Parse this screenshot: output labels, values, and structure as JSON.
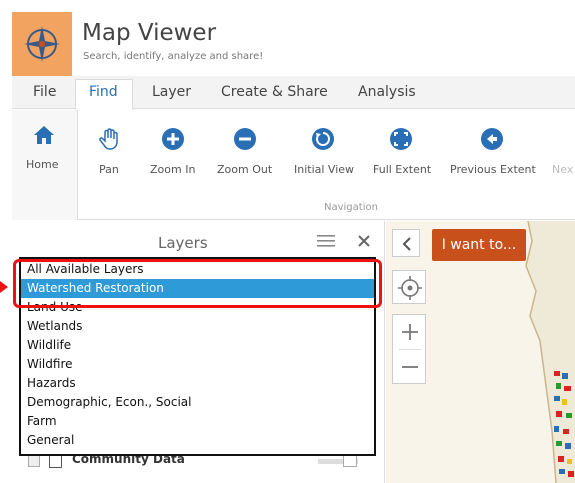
{
  "app": {
    "title": "Map Viewer",
    "subtitle": "Search, identify, analyze and share!"
  },
  "tabs": [
    "File",
    "Find",
    "Layer",
    "Create & Share",
    "Analysis"
  ],
  "ribbon": {
    "home_label": "Home",
    "tools": [
      "Pan",
      "Zoom In",
      "Zoom Out",
      "Initial View",
      "Full Extent",
      "Previous Extent",
      "Nex"
    ],
    "group_label": "Navigation"
  },
  "layers_panel": {
    "title": "Layers",
    "dropdown_options": [
      "All Available Layers",
      "Watershed Restoration",
      "Land Use",
      "Wetlands",
      "Wildlife",
      "Wildfire",
      "Hazards",
      "Demographic, Econ., Social",
      "Farm",
      "General"
    ],
    "selected": "Watershed Restoration",
    "row_label": "Community Data"
  },
  "map": {
    "i_want_label": "I want to..."
  },
  "colors": {
    "accent_orange": "#c8501b",
    "selection_blue": "#2e9bd8",
    "highlight_red": "#e11111",
    "logo_bg": "#f2a35f"
  }
}
